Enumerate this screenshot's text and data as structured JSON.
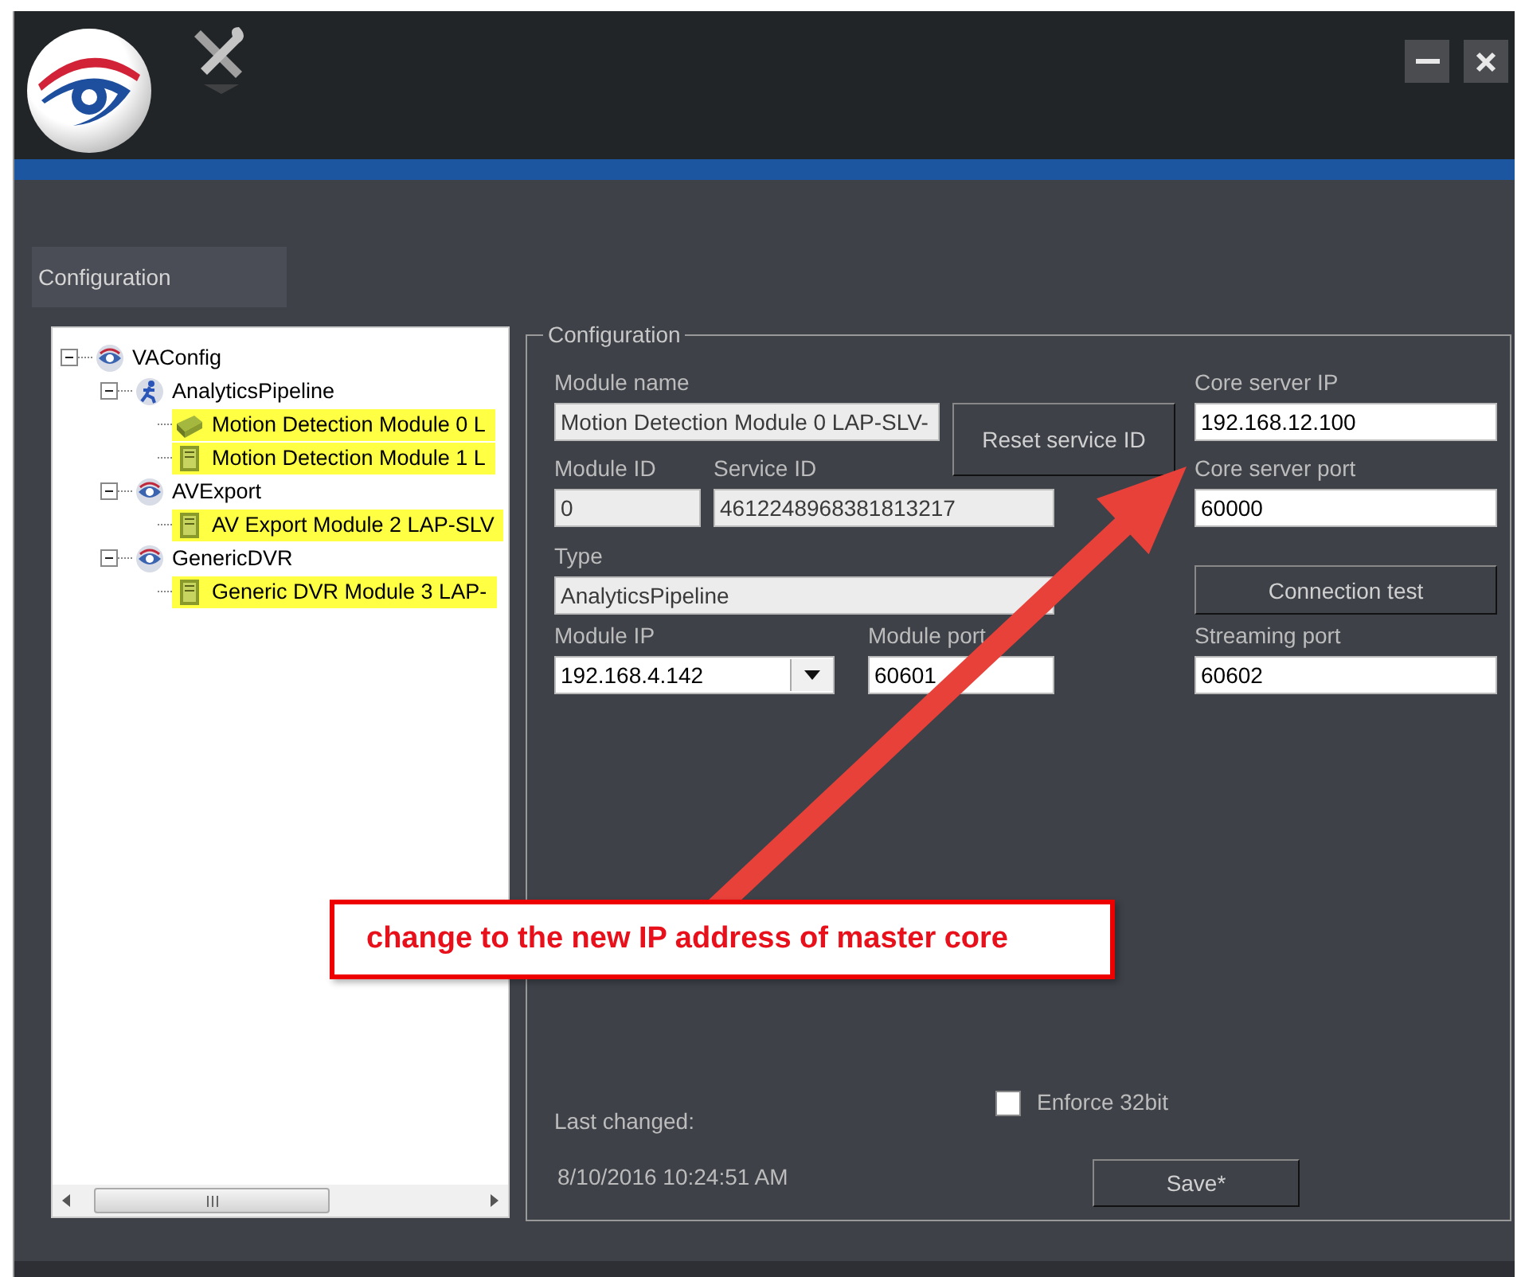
{
  "tabs": [
    {
      "label": "Configuration",
      "selected": true
    }
  ],
  "tree": [
    {
      "label": "VAConfig",
      "kind": "eye",
      "expanded": true,
      "highlighted": false,
      "children": [
        {
          "label": "AnalyticsPipeline",
          "kind": "runner",
          "expanded": true,
          "highlighted": false,
          "children": [
            {
              "label": "Motion Detection Module 0 L",
              "kind": "device",
              "highlighted": true
            },
            {
              "label": "Motion Detection Module 1 L",
              "kind": "server",
              "highlighted": true
            }
          ]
        },
        {
          "label": "AVExport",
          "kind": "eye",
          "expanded": true,
          "highlighted": false,
          "children": [
            {
              "label": "AV Export Module 2 LAP-SLV",
              "kind": "server",
              "highlighted": true
            }
          ]
        },
        {
          "label": "GenericDVR",
          "kind": "eye",
          "expanded": true,
          "highlighted": false,
          "children": [
            {
              "label": "Generic DVR Module 3 LAP-",
              "kind": "server",
              "highlighted": true
            }
          ]
        }
      ]
    }
  ],
  "config": {
    "title": "Configuration",
    "module_name": {
      "label": "Module name",
      "value": "Motion Detection Module 0 LAP-SLV-",
      "disabled": true
    },
    "reset_button": "Reset service ID",
    "module_id": {
      "label": "Module ID",
      "value": "0",
      "disabled": true
    },
    "service_id": {
      "label": "Service ID",
      "value": "4612248968381813217",
      "disabled": true
    },
    "type": {
      "label": "Type",
      "value": "AnalyticsPipeline",
      "disabled": true
    },
    "module_ip": {
      "label": "Module IP",
      "value": "192.168.4.142",
      "disabled": false
    },
    "module_port": {
      "label": "Module port",
      "value": "60601",
      "disabled": false
    },
    "core_server_ip": {
      "label": "Core server IP",
      "value": "192.168.12.100",
      "disabled": false
    },
    "core_server_port": {
      "label": "Core server port",
      "value": "60000",
      "disabled": false
    },
    "connection_test_button": "Connection test",
    "streaming_port": {
      "label": "Streaming port",
      "value": "60602",
      "disabled": false
    },
    "enforce_32bit": {
      "label": "Enforce 32bit",
      "checked": false
    },
    "last_changed_label": "Last changed:",
    "last_changed_value": "8/10/2016 10:24:51 AM",
    "save_button": "Save*"
  },
  "annotation": {
    "text": "change to the new IP address of master core"
  }
}
